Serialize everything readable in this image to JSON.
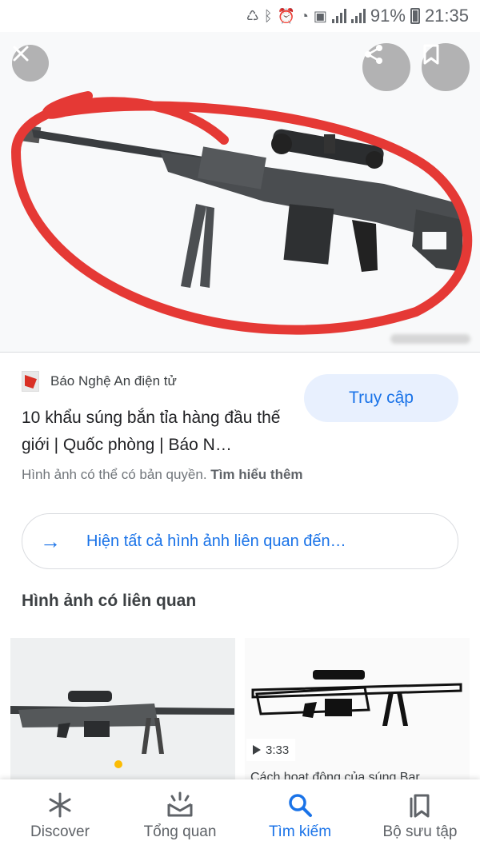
{
  "status_bar": {
    "battery": "91%",
    "time": "21:35"
  },
  "hero": {
    "close_icon": "close-icon",
    "share_icon": "share-icon",
    "save_icon": "bookmark-icon"
  },
  "result": {
    "source": "Báo Nghệ An điện tử",
    "visit_label": "Truy cập",
    "title": "10 khẩu súng bắn tỉa hàng đầu thế giới | Quốc phòng | Báo N…",
    "copyright_text": "Hình ảnh có thể có bản quyền.",
    "learn_more": "Tìm hiểu thêm"
  },
  "related_all_label": "Hiện tất cả hình ảnh liên quan đến…",
  "section_title": "Hình ảnh có liên quan",
  "thumbs": [
    {
      "kind": "image"
    },
    {
      "kind": "video",
      "duration": "3:33",
      "caption": "Cách hoạt động của súng Bar..."
    }
  ],
  "bottom_nav": [
    {
      "label": "Discover",
      "icon": "asterisk-icon",
      "active": false
    },
    {
      "label": "Tổng quan",
      "icon": "updates-icon",
      "active": false
    },
    {
      "label": "Tìm kiếm",
      "icon": "search-icon",
      "active": true
    },
    {
      "label": "Bộ sưu tập",
      "icon": "collections-icon",
      "active": false
    }
  ],
  "colors": {
    "accent": "#1a73e8",
    "annotation": "#e53935",
    "visit_bg": "#e8f0fe"
  }
}
